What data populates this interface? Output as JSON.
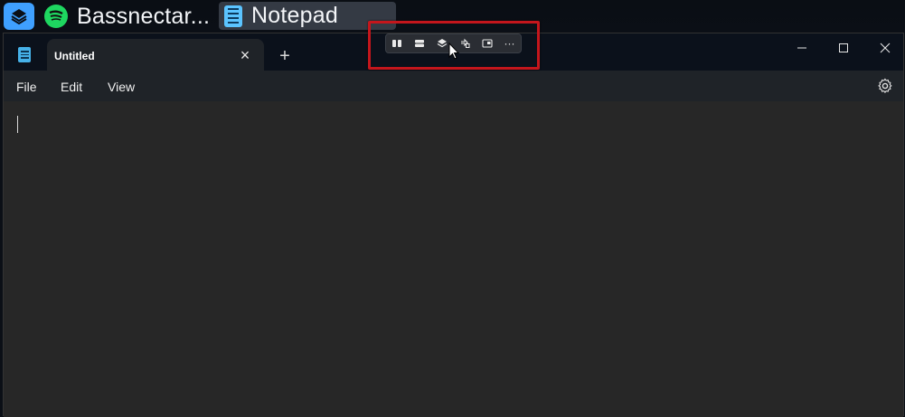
{
  "taskbar": {
    "apps": [
      {
        "label": "Bassnectar...",
        "icon": "spotify-icon"
      },
      {
        "label": "Notepad",
        "icon": "notepad-icon"
      }
    ],
    "stack_icon": "layers-icon"
  },
  "window": {
    "tab": {
      "title": "Untitled",
      "close_symbol": "×",
      "icon": "notepad-icon"
    },
    "new_tab_symbol": "+",
    "controls": {
      "minimize": "minimize-icon",
      "maximize": "maximize-icon",
      "close": "close-icon"
    }
  },
  "menu": {
    "items": [
      "File",
      "Edit",
      "View"
    ],
    "settings_icon": "gear-icon"
  },
  "snap_toolbar": {
    "buttons": [
      "split-vertical-icon",
      "split-horizontal-icon",
      "stack-icon",
      "swap-icon",
      "picture-in-picture-icon",
      "more-icon"
    ],
    "more_label": "···"
  },
  "colors": {
    "accent": "#3fa0ff",
    "spotify": "#1ed760",
    "highlight": "#c4161c",
    "editor_bg": "#272727",
    "titlebar_bg": "#0b111b"
  }
}
